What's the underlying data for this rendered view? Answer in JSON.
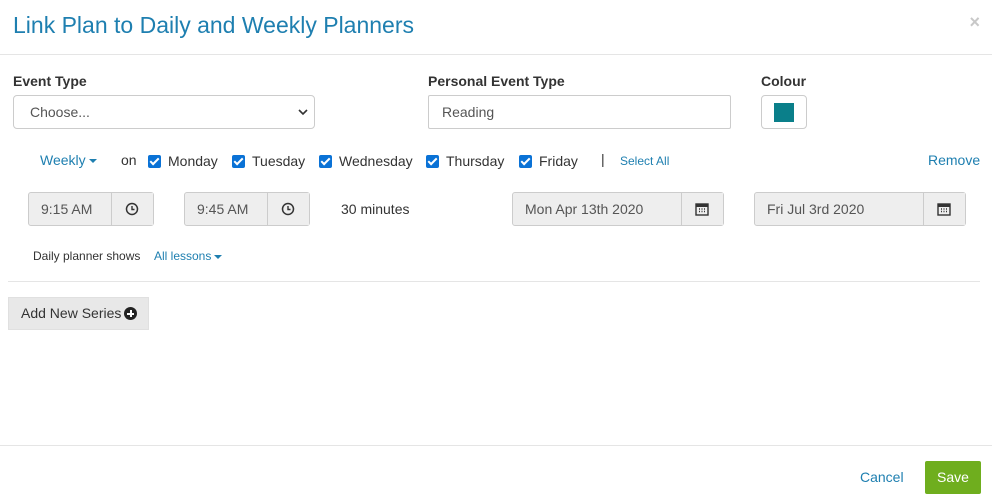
{
  "modal": {
    "title": "Link Plan to Daily and Weekly Planners",
    "close_label": "×"
  },
  "form": {
    "event_type": {
      "label": "Event Type",
      "value": "Choose..."
    },
    "personal_event_type": {
      "label": "Personal Event Type",
      "value": "Reading"
    },
    "colour": {
      "label": "Colour",
      "value": "#0a7f8a"
    }
  },
  "series": {
    "frequency": "Weekly",
    "on_label": "on",
    "days": [
      {
        "label": "Monday",
        "checked": true
      },
      {
        "label": "Tuesday",
        "checked": true
      },
      {
        "label": "Wednesday",
        "checked": true
      },
      {
        "label": "Thursday",
        "checked": true
      },
      {
        "label": "Friday",
        "checked": true
      }
    ],
    "separator": "|",
    "select_all": "Select All",
    "remove": "Remove",
    "start_time": "9:15 AM",
    "end_time": "9:45 AM",
    "duration": "30 minutes",
    "start_date": "Mon Apr 13th 2020",
    "end_date": "Fri Jul 3rd 2020",
    "daily_planner_label": "Daily planner shows",
    "daily_planner_value": "All lessons"
  },
  "actions": {
    "add_series": "Add New Series",
    "cancel": "Cancel",
    "save": "Save"
  },
  "colors": {
    "accent": "#1e7fb0",
    "save": "#6fae1e",
    "checkbox": "#0a72d6"
  }
}
